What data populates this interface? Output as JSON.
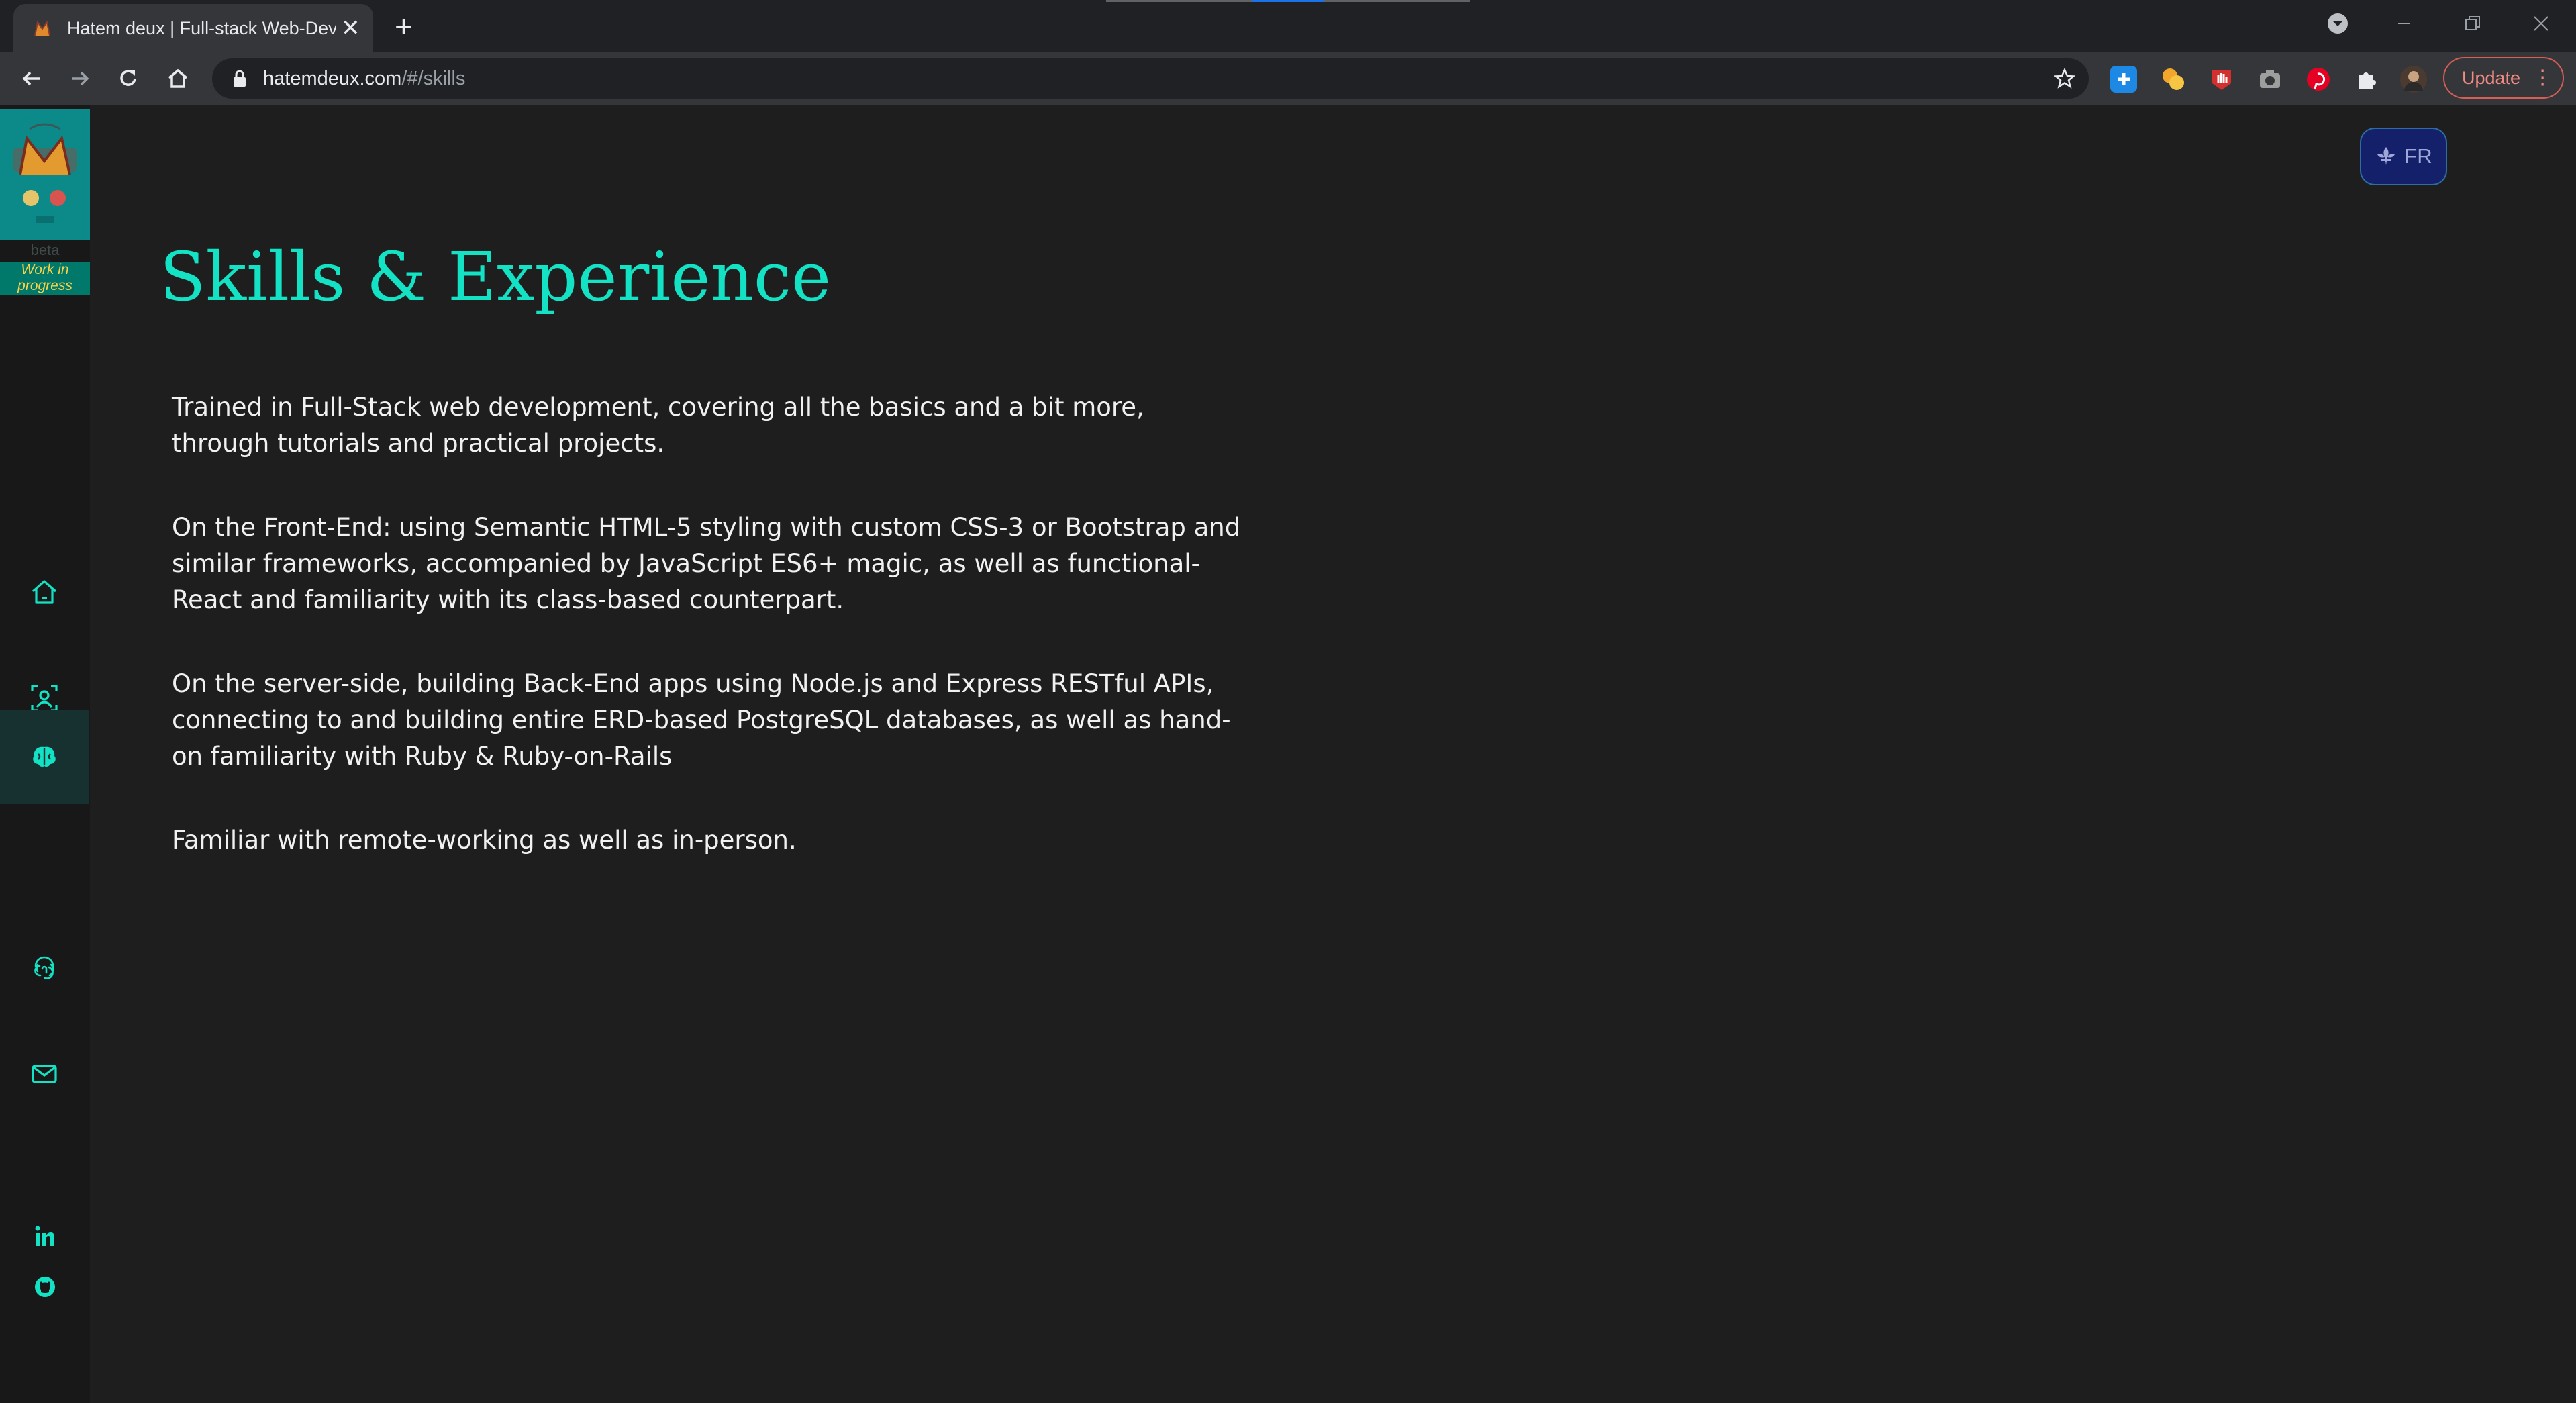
{
  "browser": {
    "tab_title": "Hatem deux | Full-stack Web-Dev",
    "url_host": "hatemdeux.com",
    "url_path": "/#/skills",
    "update_label": "Update",
    "extensions": [
      "plus-extension-icon",
      "orange-extension-icon",
      "red-hand-extension-icon",
      "camera-extension-icon",
      "pinterest-icon",
      "puzzle-icon"
    ],
    "colors": {
      "tabstrip": "#202124",
      "toolbar": "#35363a"
    }
  },
  "sidebar": {
    "beta_label": "beta",
    "wip_label": "Work in progress",
    "nav_items": [
      {
        "name": "home",
        "icon": "home-icon"
      },
      {
        "name": "about",
        "icon": "user-portrait-icon"
      },
      {
        "name": "skills",
        "icon": "brain-icon",
        "active": true
      },
      {
        "name": "work",
        "icon": "fingerprint-icon"
      },
      {
        "name": "contact",
        "icon": "mail-icon"
      }
    ],
    "social": [
      "linkedin-icon",
      "github-icon"
    ]
  },
  "language_button": {
    "label": "FR",
    "icon": "fleur-de-lis-icon"
  },
  "main": {
    "title": "Skills & Experience",
    "paragraphs": [
      "Trained in Full-Stack web development, covering all the basics and a bit more, through tutorials and practical projects.",
      "On the Front-End: using Semantic HTML-5 styling with custom CSS-3 or Bootstrap and similar frameworks, accompanied by JavaScript ES6+ magic, as well as functional-React and familiarity with its class-based counterpart.",
      "On the server-side, building Back-End apps using Node.js and Express RESTful APIs, connecting to and building entire ERD-based PostgreSQL databases, as well as hand-on familiarity with Ruby & Ruby-on-Rails",
      "Familiar with remote-working as well as in-person."
    ]
  },
  "colors": {
    "accent": "#13e3c4",
    "background": "#1e1e1e",
    "sidebar": "#181818",
    "logo_bg": "#0c8a8a",
    "fr_button": "#15206a"
  }
}
